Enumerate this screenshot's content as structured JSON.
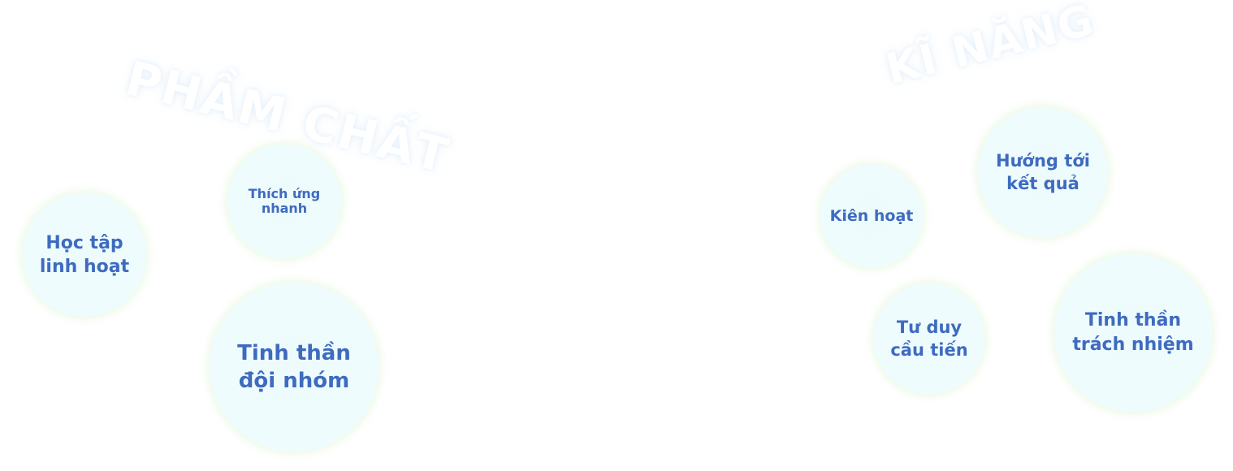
{
  "decor": {
    "left_word": "PHẦM CHẤT",
    "right_word": "KĨ NĂNG"
  },
  "bubbles": {
    "hoc_tap": "Học tập\nlinh hoạt",
    "thich_ung": "Thích ứng\nnhanh",
    "doi_nhom": "Tinh thần\nđội nhóm",
    "kien_hoat": "Kiên hoạt",
    "huong_toi": "Hướng tới\nkết quả",
    "tu_duy": "Tư duy\ncầu tiến",
    "trach_nhiem": "Tinh thần\ntrách nhiệm"
  },
  "colors": {
    "text": "#3e6bbf",
    "bubble_fill": "#eefcfe",
    "bubble_glow": "#e8f8e2"
  }
}
